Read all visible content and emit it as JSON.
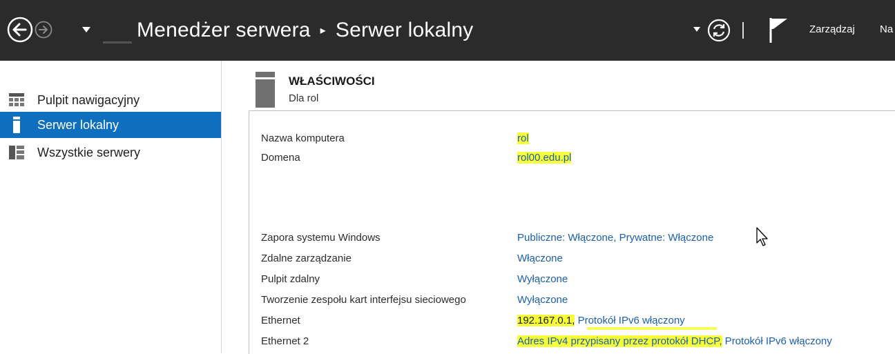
{
  "titlebar": {
    "app_name": "Menedżer serwera",
    "separator": "▸",
    "page_name": "Serwer lokalny",
    "menu_manage": "Zarządzaj",
    "menu_more": "Na",
    "bg_color": "#2b2b2b"
  },
  "sidebar": {
    "items": [
      {
        "label": "Pulpit nawigacyjny",
        "icon": "dashboard-icon",
        "active": false
      },
      {
        "label": "Serwer lokalny",
        "icon": "server-icon",
        "active": true
      },
      {
        "label": "Wszystkie serwery",
        "icon": "servers-icon",
        "active": false
      }
    ],
    "active_color": "#0d6fbe"
  },
  "properties": {
    "title": "WŁAŚCIWOŚCI",
    "subtitle": "Dla rol",
    "rows": [
      {
        "label": "Nazwa komputera",
        "value": "rol",
        "highlighted": true
      },
      {
        "label": "Domena",
        "value": "rol00.edu.pl",
        "highlighted": true
      },
      {
        "label": "Zapora systemu Windows",
        "value": "Publiczne: Włączone, Prywatne: Włączone"
      },
      {
        "label": "Zdalne zarządzanie",
        "value": "Włączone"
      },
      {
        "label": "Pulpit zdalny",
        "value": "Wyłączone"
      },
      {
        "label": "Tworzenie zespołu kart interfejsu sieciowego",
        "value": "Wyłączone"
      },
      {
        "label": "Ethernet",
        "value_part1": "192.167.0.1,",
        "value_part2": " Protokół IPv6 włączony"
      },
      {
        "label": "Ethernet 2",
        "value_part1": "Adres IPv4 przypisany przez protokół DHCP,",
        "value_part2": " Protokół IPv6 włączony"
      }
    ],
    "highlight_color": "#f6ff3a",
    "link_color": "#1b5fab"
  }
}
